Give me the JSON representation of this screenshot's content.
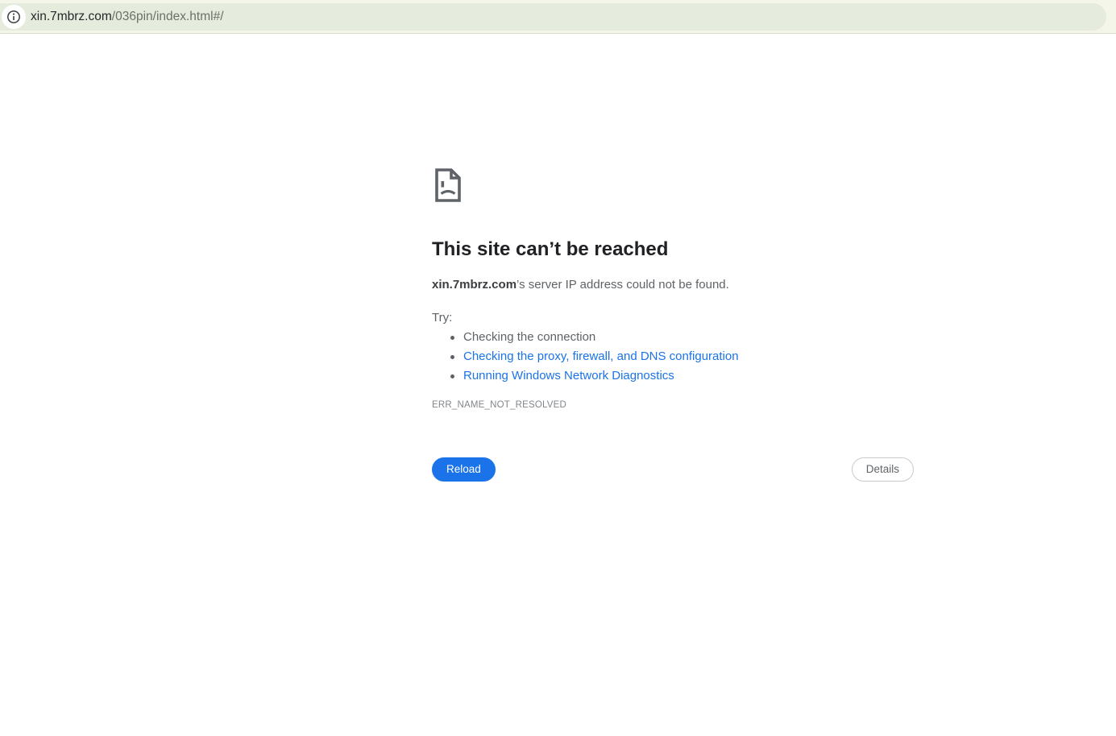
{
  "toolbar": {
    "url_domain": "xin.7mbrz.com",
    "url_path": "/036pin/index.html#/"
  },
  "main": {
    "title": "This site can’t be reached",
    "message_domain": "xin.7mbrz.com",
    "message_rest": "’s server IP address could not be found.",
    "try_label": "Try:",
    "suggestions": [
      {
        "label": "Checking the connection",
        "is_link": false
      },
      {
        "label": "Checking the proxy, firewall, and DNS configuration",
        "is_link": true
      },
      {
        "label": "Running Windows Network Diagnostics",
        "is_link": true
      }
    ],
    "error_code": "ERR_NAME_NOT_RESOLVED",
    "reload_button_label": "Reload",
    "details_button_label": "Details"
  },
  "icons": {
    "page_info": "info-icon",
    "sad_file": "sad-file-icon"
  },
  "colors": {
    "accent_blue": "#1a73e8",
    "link_blue": "#1a73e8",
    "toolbar_cream": "#f4f6ea",
    "address_pill_green": "#e5ecdd",
    "text_dark": "#202124",
    "text_gray": "#5f6368",
    "error_code_gray": "#80868b",
    "icon_gray": "#5f6368"
  }
}
